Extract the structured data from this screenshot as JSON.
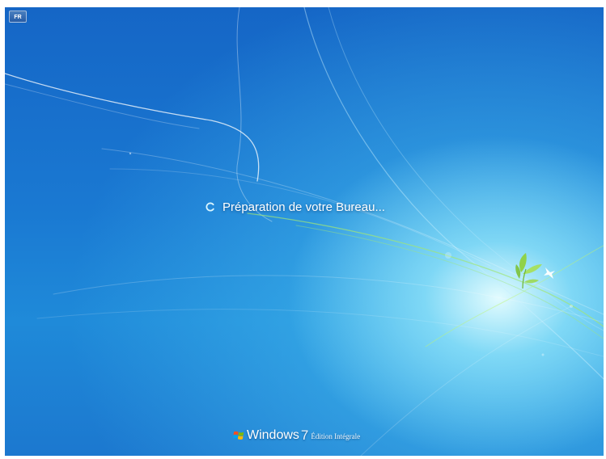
{
  "language_indicator": {
    "label": "FR"
  },
  "status": {
    "message": "Préparation de votre Bureau...",
    "icon": "spinner-icon"
  },
  "branding": {
    "logo_icon": "windows-flag-icon",
    "name": "Windows",
    "version": "7",
    "edition": "Édition Intégrale"
  },
  "colors": {
    "background_top": "#1566c6",
    "background_bottom": "#1c78cf",
    "glow": "#ebffff",
    "text": "#ffffff",
    "leaf_green": "#8fd13f"
  }
}
